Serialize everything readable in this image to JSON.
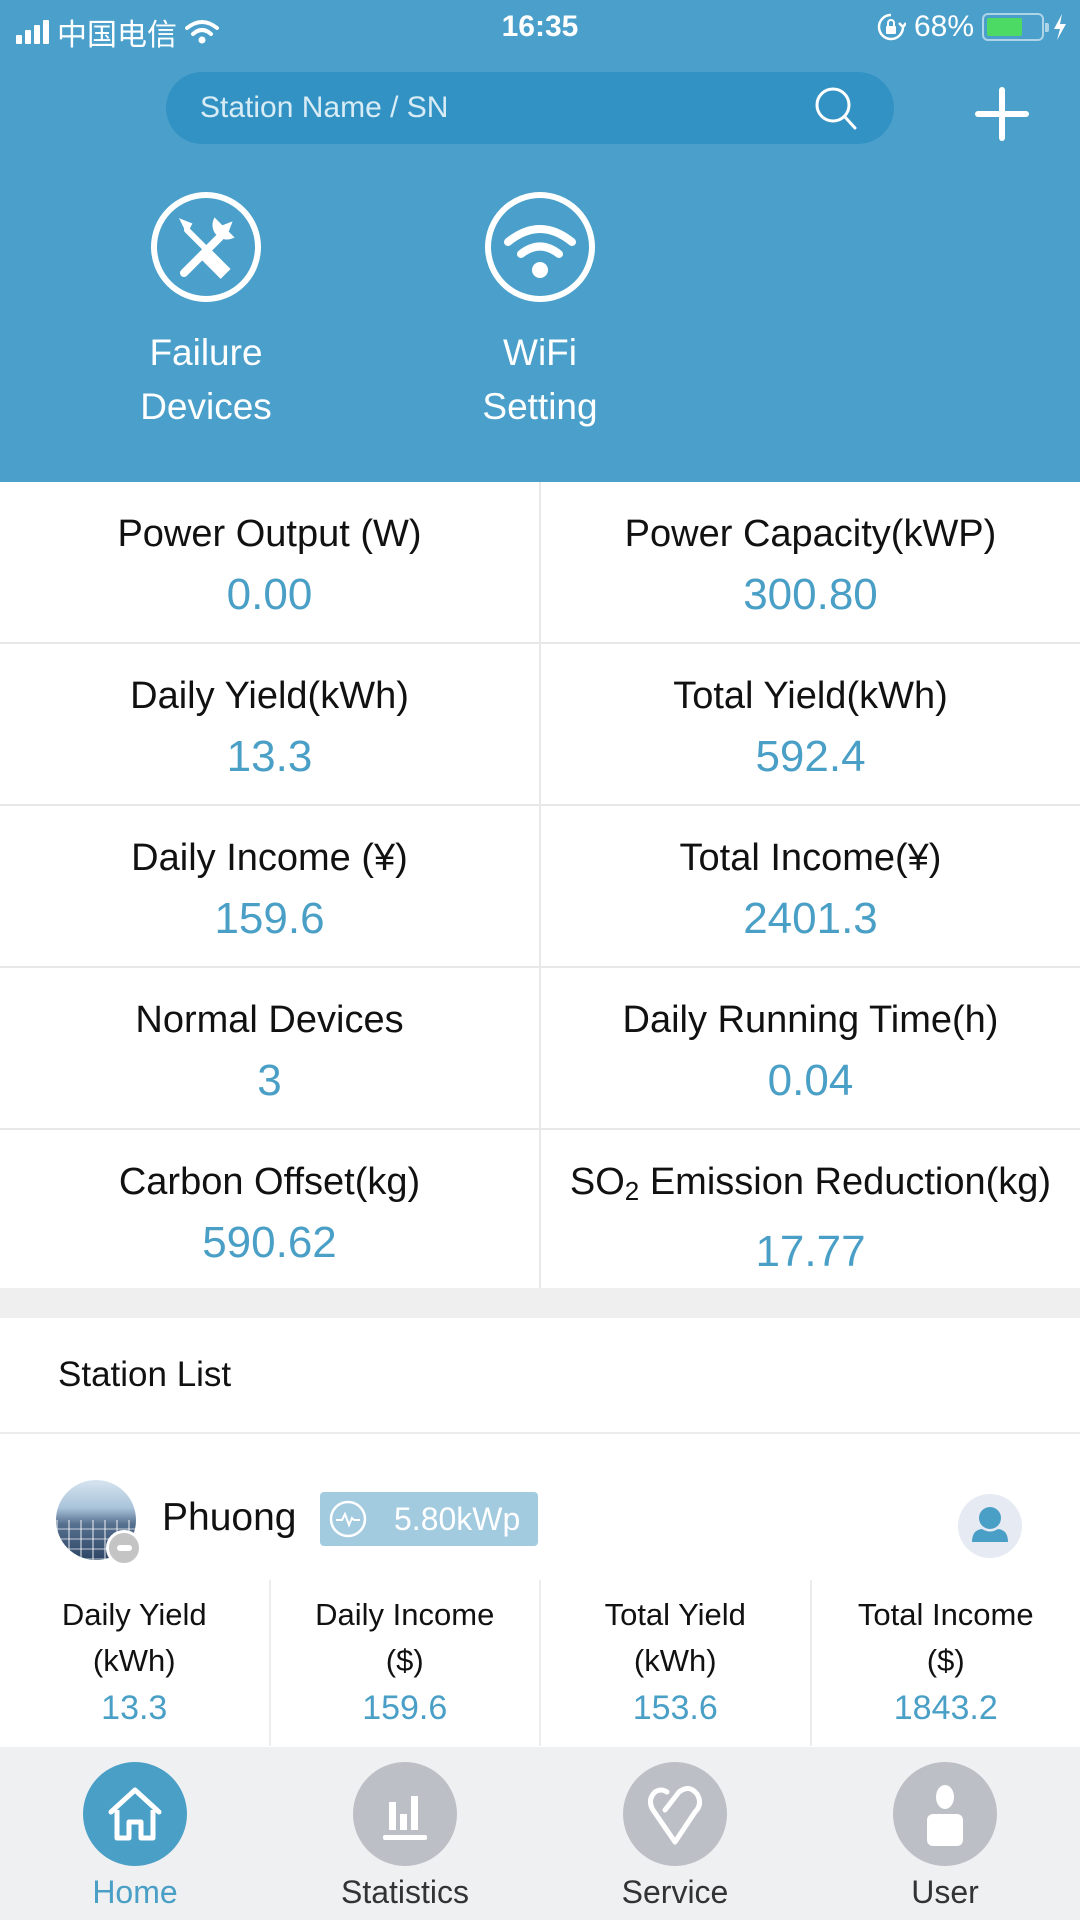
{
  "status_bar": {
    "carrier": "中国电信",
    "time": "16:35",
    "battery_percent": "68%",
    "battery_level": 0.68
  },
  "header": {
    "search": {
      "placeholder": "Station Name / SN",
      "value": ""
    },
    "quick_actions": [
      {
        "label_line1": "Failure",
        "label_line2": "Devices",
        "icon": "tools-icon"
      },
      {
        "label_line1": "WiFi",
        "label_line2": "Setting",
        "icon": "wifi-icon"
      }
    ]
  },
  "stats": [
    {
      "label": "Power Output (W)",
      "value": "0.00"
    },
    {
      "label": "Power Capacity(kWP)",
      "value": "300.80"
    },
    {
      "label": "Daily Yield(kWh)",
      "value": "13.3"
    },
    {
      "label": "Total Yield(kWh)",
      "value": "592.4"
    },
    {
      "label": "Daily Income (¥)",
      "value": "159.6"
    },
    {
      "label": "Total Income(¥)",
      "value": "2401.3"
    },
    {
      "label": "Normal Devices",
      "value": "3"
    },
    {
      "label": "Daily Running Time(h)",
      "value": "0.04"
    },
    {
      "label": "Carbon Offset(kg)",
      "value": "590.62"
    },
    {
      "label_prefix": "SO",
      "label_sub": "2",
      "label_suffix": " Emission Reduction(kg)",
      "value": "17.77"
    }
  ],
  "station_list": {
    "title": "Station List",
    "stations": [
      {
        "name": "Phuong",
        "capacity": "5.80kWp",
        "metrics": [
          {
            "label_line1": "Daily Yield",
            "label_line2": "(kWh)",
            "value": "13.3"
          },
          {
            "label_line1": "Daily Income",
            "label_line2": "($)",
            "value": "159.6"
          },
          {
            "label_line1": "Total Yield",
            "label_line2": "(kWh)",
            "value": "153.6"
          },
          {
            "label_line1": "Total Income",
            "label_line2": "($)",
            "value": "1843.2"
          }
        ]
      }
    ]
  },
  "tabbar": {
    "tabs": [
      {
        "label": "Home",
        "icon": "home-icon",
        "active": true
      },
      {
        "label": "Statistics",
        "icon": "bar-chart-icon",
        "active": false
      },
      {
        "label": "Service",
        "icon": "heart-icon",
        "active": false
      },
      {
        "label": "User",
        "icon": "user-icon",
        "active": false
      }
    ]
  },
  "colors": {
    "header_bg": "#4aa0cb",
    "search_bg": "#3292c4",
    "accent": "#4a9fc6",
    "tab_inactive": "#bcbfc6",
    "battery_green": "#4cd964"
  }
}
